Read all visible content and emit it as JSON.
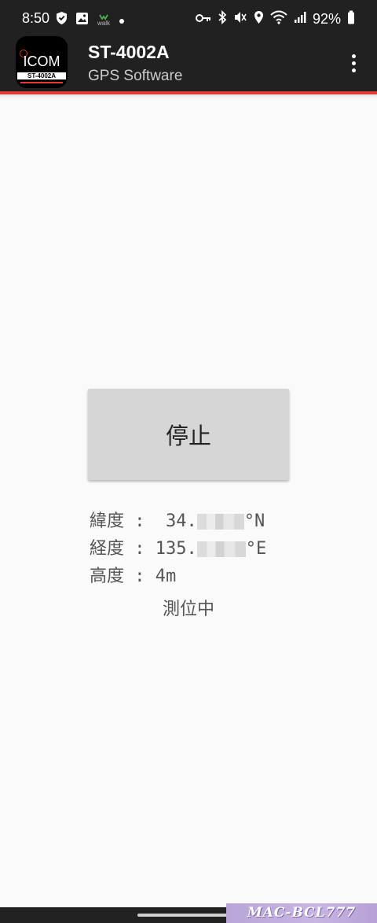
{
  "status_bar": {
    "time": "8:50",
    "walk_label": "walk",
    "battery_percent": "92%",
    "icons": [
      "shield-icon",
      "gallery-icon",
      "walk-icon",
      "notification-dot-icon",
      "key-icon",
      "bluetooth-icon",
      "mute-icon",
      "location-icon",
      "wifi-icon",
      "signal-icon",
      "battery-icon"
    ]
  },
  "app_bar": {
    "logo_brand": "ICOM",
    "logo_model": "ST-4002A",
    "title": "ST-4002A",
    "subtitle": "GPS Software",
    "menu_icon": "more-vert-icon",
    "accent_color": "#e53935",
    "background_color": "#212121"
  },
  "main": {
    "stop_button_label": "停止",
    "gps": {
      "latitude_label": "緯度",
      "latitude_prefix": " 34.",
      "latitude_suffix": "°N",
      "longitude_label": "経度",
      "longitude_prefix": "135.",
      "longitude_suffix": "°E",
      "altitude_label": "高度",
      "altitude_value": "4m",
      "separator": ":"
    },
    "status_text": "測位中"
  },
  "watermark": {
    "text": "MAC-BCL777"
  }
}
